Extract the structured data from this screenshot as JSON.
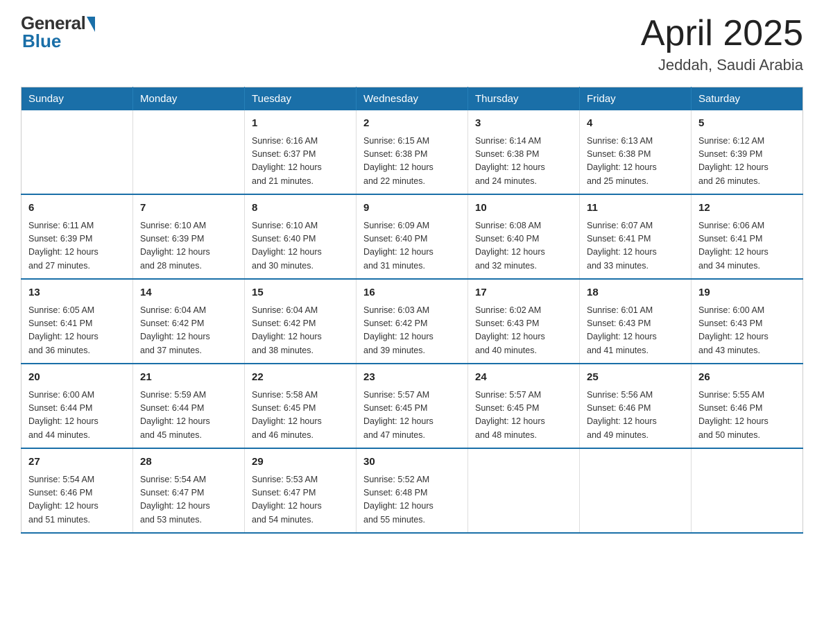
{
  "header": {
    "logo_general": "General",
    "logo_blue": "Blue",
    "title": "April 2025",
    "location": "Jeddah, Saudi Arabia"
  },
  "weekdays": [
    "Sunday",
    "Monday",
    "Tuesday",
    "Wednesday",
    "Thursday",
    "Friday",
    "Saturday"
  ],
  "weeks": [
    [
      {
        "day": "",
        "info": ""
      },
      {
        "day": "",
        "info": ""
      },
      {
        "day": "1",
        "info": "Sunrise: 6:16 AM\nSunset: 6:37 PM\nDaylight: 12 hours\nand 21 minutes."
      },
      {
        "day": "2",
        "info": "Sunrise: 6:15 AM\nSunset: 6:38 PM\nDaylight: 12 hours\nand 22 minutes."
      },
      {
        "day": "3",
        "info": "Sunrise: 6:14 AM\nSunset: 6:38 PM\nDaylight: 12 hours\nand 24 minutes."
      },
      {
        "day": "4",
        "info": "Sunrise: 6:13 AM\nSunset: 6:38 PM\nDaylight: 12 hours\nand 25 minutes."
      },
      {
        "day": "5",
        "info": "Sunrise: 6:12 AM\nSunset: 6:39 PM\nDaylight: 12 hours\nand 26 minutes."
      }
    ],
    [
      {
        "day": "6",
        "info": "Sunrise: 6:11 AM\nSunset: 6:39 PM\nDaylight: 12 hours\nand 27 minutes."
      },
      {
        "day": "7",
        "info": "Sunrise: 6:10 AM\nSunset: 6:39 PM\nDaylight: 12 hours\nand 28 minutes."
      },
      {
        "day": "8",
        "info": "Sunrise: 6:10 AM\nSunset: 6:40 PM\nDaylight: 12 hours\nand 30 minutes."
      },
      {
        "day": "9",
        "info": "Sunrise: 6:09 AM\nSunset: 6:40 PM\nDaylight: 12 hours\nand 31 minutes."
      },
      {
        "day": "10",
        "info": "Sunrise: 6:08 AM\nSunset: 6:40 PM\nDaylight: 12 hours\nand 32 minutes."
      },
      {
        "day": "11",
        "info": "Sunrise: 6:07 AM\nSunset: 6:41 PM\nDaylight: 12 hours\nand 33 minutes."
      },
      {
        "day": "12",
        "info": "Sunrise: 6:06 AM\nSunset: 6:41 PM\nDaylight: 12 hours\nand 34 minutes."
      }
    ],
    [
      {
        "day": "13",
        "info": "Sunrise: 6:05 AM\nSunset: 6:41 PM\nDaylight: 12 hours\nand 36 minutes."
      },
      {
        "day": "14",
        "info": "Sunrise: 6:04 AM\nSunset: 6:42 PM\nDaylight: 12 hours\nand 37 minutes."
      },
      {
        "day": "15",
        "info": "Sunrise: 6:04 AM\nSunset: 6:42 PM\nDaylight: 12 hours\nand 38 minutes."
      },
      {
        "day": "16",
        "info": "Sunrise: 6:03 AM\nSunset: 6:42 PM\nDaylight: 12 hours\nand 39 minutes."
      },
      {
        "day": "17",
        "info": "Sunrise: 6:02 AM\nSunset: 6:43 PM\nDaylight: 12 hours\nand 40 minutes."
      },
      {
        "day": "18",
        "info": "Sunrise: 6:01 AM\nSunset: 6:43 PM\nDaylight: 12 hours\nand 41 minutes."
      },
      {
        "day": "19",
        "info": "Sunrise: 6:00 AM\nSunset: 6:43 PM\nDaylight: 12 hours\nand 43 minutes."
      }
    ],
    [
      {
        "day": "20",
        "info": "Sunrise: 6:00 AM\nSunset: 6:44 PM\nDaylight: 12 hours\nand 44 minutes."
      },
      {
        "day": "21",
        "info": "Sunrise: 5:59 AM\nSunset: 6:44 PM\nDaylight: 12 hours\nand 45 minutes."
      },
      {
        "day": "22",
        "info": "Sunrise: 5:58 AM\nSunset: 6:45 PM\nDaylight: 12 hours\nand 46 minutes."
      },
      {
        "day": "23",
        "info": "Sunrise: 5:57 AM\nSunset: 6:45 PM\nDaylight: 12 hours\nand 47 minutes."
      },
      {
        "day": "24",
        "info": "Sunrise: 5:57 AM\nSunset: 6:45 PM\nDaylight: 12 hours\nand 48 minutes."
      },
      {
        "day": "25",
        "info": "Sunrise: 5:56 AM\nSunset: 6:46 PM\nDaylight: 12 hours\nand 49 minutes."
      },
      {
        "day": "26",
        "info": "Sunrise: 5:55 AM\nSunset: 6:46 PM\nDaylight: 12 hours\nand 50 minutes."
      }
    ],
    [
      {
        "day": "27",
        "info": "Sunrise: 5:54 AM\nSunset: 6:46 PM\nDaylight: 12 hours\nand 51 minutes."
      },
      {
        "day": "28",
        "info": "Sunrise: 5:54 AM\nSunset: 6:47 PM\nDaylight: 12 hours\nand 53 minutes."
      },
      {
        "day": "29",
        "info": "Sunrise: 5:53 AM\nSunset: 6:47 PM\nDaylight: 12 hours\nand 54 minutes."
      },
      {
        "day": "30",
        "info": "Sunrise: 5:52 AM\nSunset: 6:48 PM\nDaylight: 12 hours\nand 55 minutes."
      },
      {
        "day": "",
        "info": ""
      },
      {
        "day": "",
        "info": ""
      },
      {
        "day": "",
        "info": ""
      }
    ]
  ]
}
